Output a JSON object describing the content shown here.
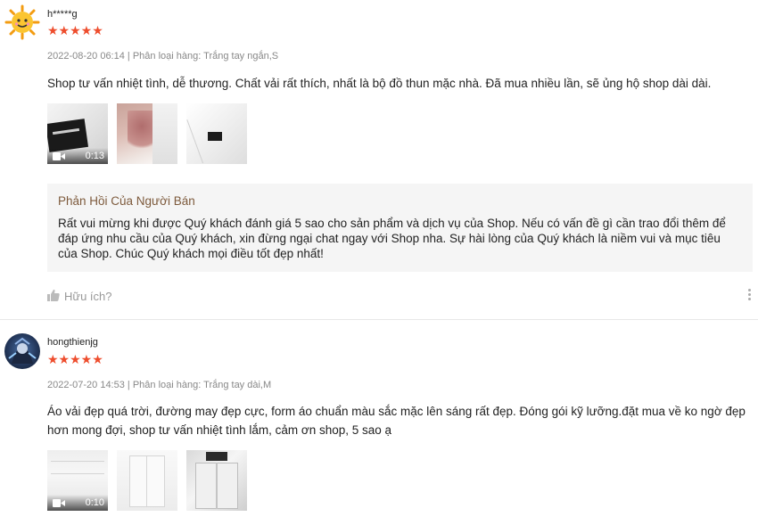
{
  "reviews": [
    {
      "username": "h*****g",
      "rating_stars": "★★★★★",
      "rating": 5,
      "meta": "2022-08-20 06:14 | Phân loại hàng: Trắng tay ngắn,S",
      "text": "Shop tư vấn nhiệt tình, dễ thương. Chất vải rất thích, nhất là bộ đồ thun mặc nhà. Đã mua nhiều lần, sẽ ủng hộ shop dài dài.",
      "video_duration": "0:13",
      "avatar_icon": "sun-avatar-icon",
      "seller_reply": {
        "title": "Phản Hồi Của Người Bán",
        "text": "Rất vui mừng khi được Quý khách đánh giá 5 sao cho sản phẩm và dịch vụ của Shop. Nếu có vấn đề gì cần trao đổi thêm để đáp ứng nhu cầu của Quý khách, xin đừng ngại chat ngay với Shop nha. Sự hài lòng của Quý khách là niềm vui và mục tiêu của Shop. Chúc Quý khách mọi điều tốt đẹp nhất!"
      },
      "helpful_label": "Hữu ích?"
    },
    {
      "username": "hongthienjg",
      "rating_stars": "★★★★★",
      "rating": 5,
      "meta": "2022-07-20 14:53 | Phân loại hàng: Trắng tay dài,M",
      "text": "Áo vải đẹp quá trời, đường may đẹp cực, form áo chuẩn màu sắc mặc lên sáng rất đẹp. Đóng gói kỹ lưỡng.đặt mua về ko ngờ đẹp hơn mong đợi, shop tư vấn nhiệt tình lắm, cảm ơn shop, 5 sao ạ",
      "video_duration": "0:10",
      "avatar_icon": "game-character-avatar-icon"
    }
  ],
  "colors": {
    "star": "#ee4d2d",
    "reply_title": "#7d5a3c",
    "reply_bg": "#f5f5f5",
    "meta": "#888888"
  }
}
